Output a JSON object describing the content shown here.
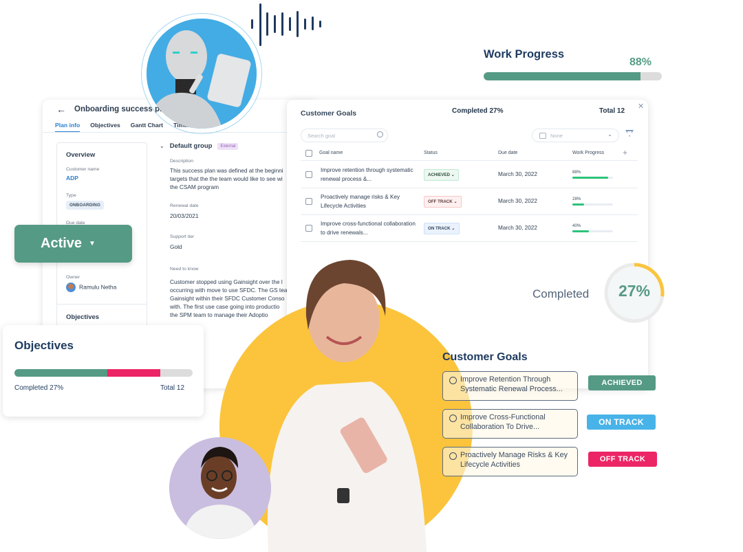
{
  "plan_panel": {
    "back_icon": "arrow-left-icon",
    "title": "Onboarding success plan",
    "tabs": [
      "Plan info",
      "Objectives",
      "Gantt Chart",
      "Timeline"
    ],
    "active_tab": "Plan info",
    "overview": {
      "title": "Overview",
      "customer_name_label": "Customer name",
      "customer_name": "ADP",
      "type_label": "Type",
      "type_value": "ONBOARDING",
      "due_date_label": "Due date",
      "owner_label": "Owner",
      "owner_name": "Ramulu Netha",
      "objectives_label": "Objectives"
    },
    "group": {
      "title": "Default group",
      "badge": "External",
      "description_label": "Description",
      "description_lines": [
        "This success plan was defined at the beginni",
        "targets that the the team would like to see wi",
        "the CSAM program"
      ],
      "renewal_label": "Renewal date",
      "renewal_value": "20/03/2021",
      "support_label": "Support tier",
      "support_value": "Gold",
      "need_label": "Need to know",
      "need_lines": [
        "Customer stopped using Gainsight over the l",
        "occurring with move to use SFDC. The GS tea",
        "Gainsight within their SFDC Customer Conso",
        "with. The first use case going into productio",
        "the SPM team to manage their Adoptio"
      ]
    }
  },
  "goals_panel": {
    "title": "Customer Goals",
    "completed": "Completed 27%",
    "total": "Total 12",
    "search_placeholder": "Search goal",
    "group_by_value": "None",
    "columns": [
      "Goal name",
      "Status",
      "Due date",
      "Work Progress"
    ],
    "rows": [
      {
        "name": "Improve retention through systematic renewal process &...",
        "status": "ACHIEVED",
        "due": "March 30, 2022",
        "progress_label": "88%",
        "progress": 88
      },
      {
        "name": "Proactively manage risks & Key Lifecycle Activities",
        "status": "OFF TRACK",
        "due": "March 30, 2022",
        "progress_label": "28%",
        "progress": 28
      },
      {
        "name": "Improve cross-functional collaboration to drive renewals...",
        "status": "ON TRACK",
        "due": "March 30, 2022",
        "progress_label": "40%",
        "progress": 40
      }
    ]
  },
  "work_progress": {
    "title": "Work Progress",
    "percent_label": "88%",
    "percent": 88
  },
  "active_dropdown": {
    "label": "Active"
  },
  "objectives_card": {
    "title": "Objectives",
    "completed": "Completed 27%",
    "total": "Total 12",
    "segments": [
      {
        "name": "completed",
        "fraction": 0.52,
        "color": "#559a84"
      },
      {
        "name": "off-track",
        "fraction": 0.3,
        "color": "#ec2566"
      }
    ]
  },
  "completed_ring": {
    "label": "Completed",
    "percent_label": "27%",
    "percent": 27,
    "color": "#fbc43c"
  },
  "customer_goals_overlay": {
    "title": "Customer Goals",
    "items": [
      {
        "text": "Improve Retention Through Systematic Renewal Process...",
        "status": "ACHIEVED",
        "color": "#559a84"
      },
      {
        "text": "Improve Cross-Functional Collaboration To Drive...",
        "status": "ON TRACK",
        "color": "#48b3e8"
      },
      {
        "text": "Proactively Manage Risks & Key Lifecycle Activities",
        "status": "OFF TRACK",
        "color": "#ec2566"
      }
    ]
  },
  "colors": {
    "brand_green": "#559a84",
    "navy": "#1d3a5f",
    "yellow": "#fbc43c",
    "pink": "#ec2566",
    "sky": "#48b3e8"
  }
}
